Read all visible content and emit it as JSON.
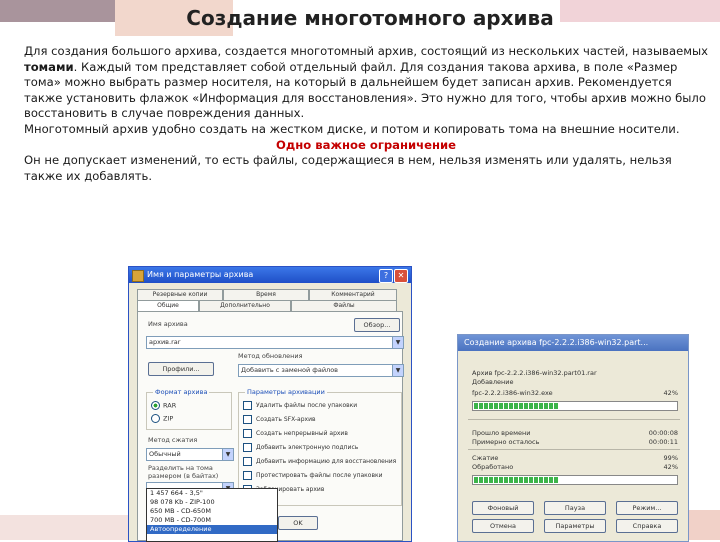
{
  "slide": {
    "title": "Создание многотомного архива",
    "p1_a": "Для создания большого архива, создается многотомный архив, состоящий из нескольких частей, называемых ",
    "p1_bold": "томами",
    "p1_b": ". Каждый том представляет собой отдельный файл. Для создания такова архива, в поле «Размер тома» можно выбрать размер носителя, на который в дальнейшем будет записан архив. Рекомендуется также установить флажок «Информация для восстановления». Это нужно для того, чтобы архив можно было восстановить в случае повреждения данных.",
    "p2": "Многотомный архив удобно создать на жестком диске, и потом и копировать тома на внешние носители.",
    "p3_heading": "Одно важное ограничение",
    "p4": " Он не допускает изменений, то есть файлы, содержащиеся в нем, нельзя изменять или удалять, нельзя также их добавлять."
  },
  "dialog_archive": {
    "title": "Имя и параметры архива",
    "help": "?",
    "close": "✕",
    "tabs_top": [
      "Резервные копии",
      "Время",
      "Комментарий"
    ],
    "tabs_bottom": [
      "Общие",
      "Дополнительно",
      "Файлы"
    ],
    "archive_name_label": "Имя архива",
    "archive_name_value": "архив.rar",
    "browse_button": "Обзор...",
    "update_mode_label": "Метод обновления",
    "update_mode_value": "Добавить с заменой файлов",
    "profiles_button": "Профили...",
    "archive_format_title": "Формат архива",
    "format_rar": "RAR",
    "format_zip": "ZIP",
    "compression_label": "Метод сжатия",
    "compression_value": "Обычный",
    "volume_size_label": "Разделить на тома размером (в байтах)",
    "volume_size_value": "",
    "archive_options_title": "Параметры архивации",
    "options": [
      "Удалить файлы после упаковки",
      "Создать SFX-архив",
      "Создать непрерывный архив",
      "Добавить электронную подпись",
      "Добавить информацию для восстановления",
      "Протестировать файлы после упаковки",
      "Заблокировать архив"
    ],
    "dropdown_options": [
      "1 457 664 - 3,5\"",
      "98 078 Kb - ZIP-100",
      "650 MB - CD-650M",
      "700 MB - CD-700M",
      "Автоопределение"
    ],
    "ok_button": "OK"
  },
  "dialog_progress": {
    "title": "Создание архива fpc-2.2.2.i386-win32.part...",
    "archive_line": "Архив fpc-2.2.2.i386-win32.part01.rar",
    "adding_label": "Добавление",
    "file_name": "fpc-2.2.2.i386-win32.exe",
    "file_percent": "42%",
    "file_progress": 0.42,
    "elapsed_label": "Прошло времени",
    "elapsed_value": "00:00:08",
    "remaining_label": "Примерно осталось",
    "remaining_value": "00:00:11",
    "ratio_label": "Сжатие",
    "ratio_value": "99%",
    "processed_label": "Обработано",
    "processed_value": "42%",
    "total_progress": 0.42,
    "background_button": "Фоновый",
    "pause_button": "Пауза",
    "mode_button": "Режим...",
    "cancel_button": "Отмена",
    "parameters_button": "Параметры",
    "help_button": "Справка"
  }
}
